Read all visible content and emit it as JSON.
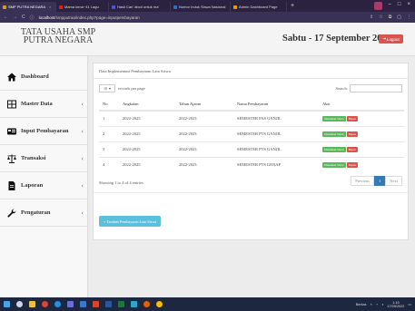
{
  "browser": {
    "tabs": [
      {
        "label": "SMP PUTRA NEGARA",
        "color": "#d4a020"
      },
      {
        "label": "Mama kena~41 Lagu",
        "color": "#e02020"
      },
      {
        "label": "Hasil Cari 'abcd untuk ma'",
        "color": "#5050e0"
      },
      {
        "label": "Nomor Induk Siswa Nasional",
        "color": "#3070c0"
      },
      {
        "label": "Admin Dashboard Page",
        "color": "#e0a000"
      }
    ],
    "url_host": "localhost",
    "url_path": "/smpputraa/index.php?page=inputpembayaran"
  },
  "header": {
    "school_name": "TATA USAHA SMP PUTRA NEGARA",
    "date": "Sabtu - 17 September 2022",
    "logout_label": "Logout"
  },
  "sidebar": {
    "items": [
      {
        "label": "Dashboard",
        "icon": "home-icon",
        "has_submenu": false
      },
      {
        "label": "Master Data",
        "icon": "grid-icon",
        "has_submenu": true
      },
      {
        "label": "Input Pembayaran",
        "icon": "card-icon",
        "has_submenu": true
      },
      {
        "label": "Transaksi",
        "icon": "scale-icon",
        "has_submenu": true
      },
      {
        "label": "Laporan",
        "icon": "file-icon",
        "has_submenu": true
      },
      {
        "label": "Pengaturan",
        "icon": "wrench-icon",
        "has_submenu": true
      }
    ]
  },
  "panel": {
    "title": "Data Implementasi Pembayaran Lain Siswa",
    "page_size": "10",
    "page_size_label": "records per page",
    "search_label": "Search:",
    "columns": [
      "No",
      "Angkatan",
      "Tahun Ajaran",
      "Nama Pembayaran",
      "Aksi"
    ],
    "rows": [
      [
        "1",
        "2022-2025",
        "2022-2023",
        "SEMESTER PAS GANJIL"
      ],
      [
        "2",
        "2022-2025",
        "2022-2023",
        "SEMESTER PTS GANJIL"
      ],
      [
        "3",
        "2022-2025",
        "2022-2023",
        "SEMESTER PTS GANJIL"
      ],
      [
        "4",
        "2022-2025",
        "2022-2023",
        "SEMESTER PTS GENAP"
      ]
    ],
    "action_primary": "Masukkan Siswa",
    "action_delete": "Hapus",
    "info": "Showing 1 to 4 of 4 entries",
    "pager": {
      "prev": "Previous",
      "current": "1",
      "next": "Next"
    },
    "add_button": "+ Tambah Pembayaran Lain Siswa"
  },
  "taskbar": {
    "tray_text": "Berkas",
    "time": "1:19",
    "date": "17/09/2022"
  },
  "colors": {
    "accent_blue": "#337ab7",
    "danger": "#d9534f",
    "success": "#5cb85c",
    "info": "#5bc0de"
  }
}
